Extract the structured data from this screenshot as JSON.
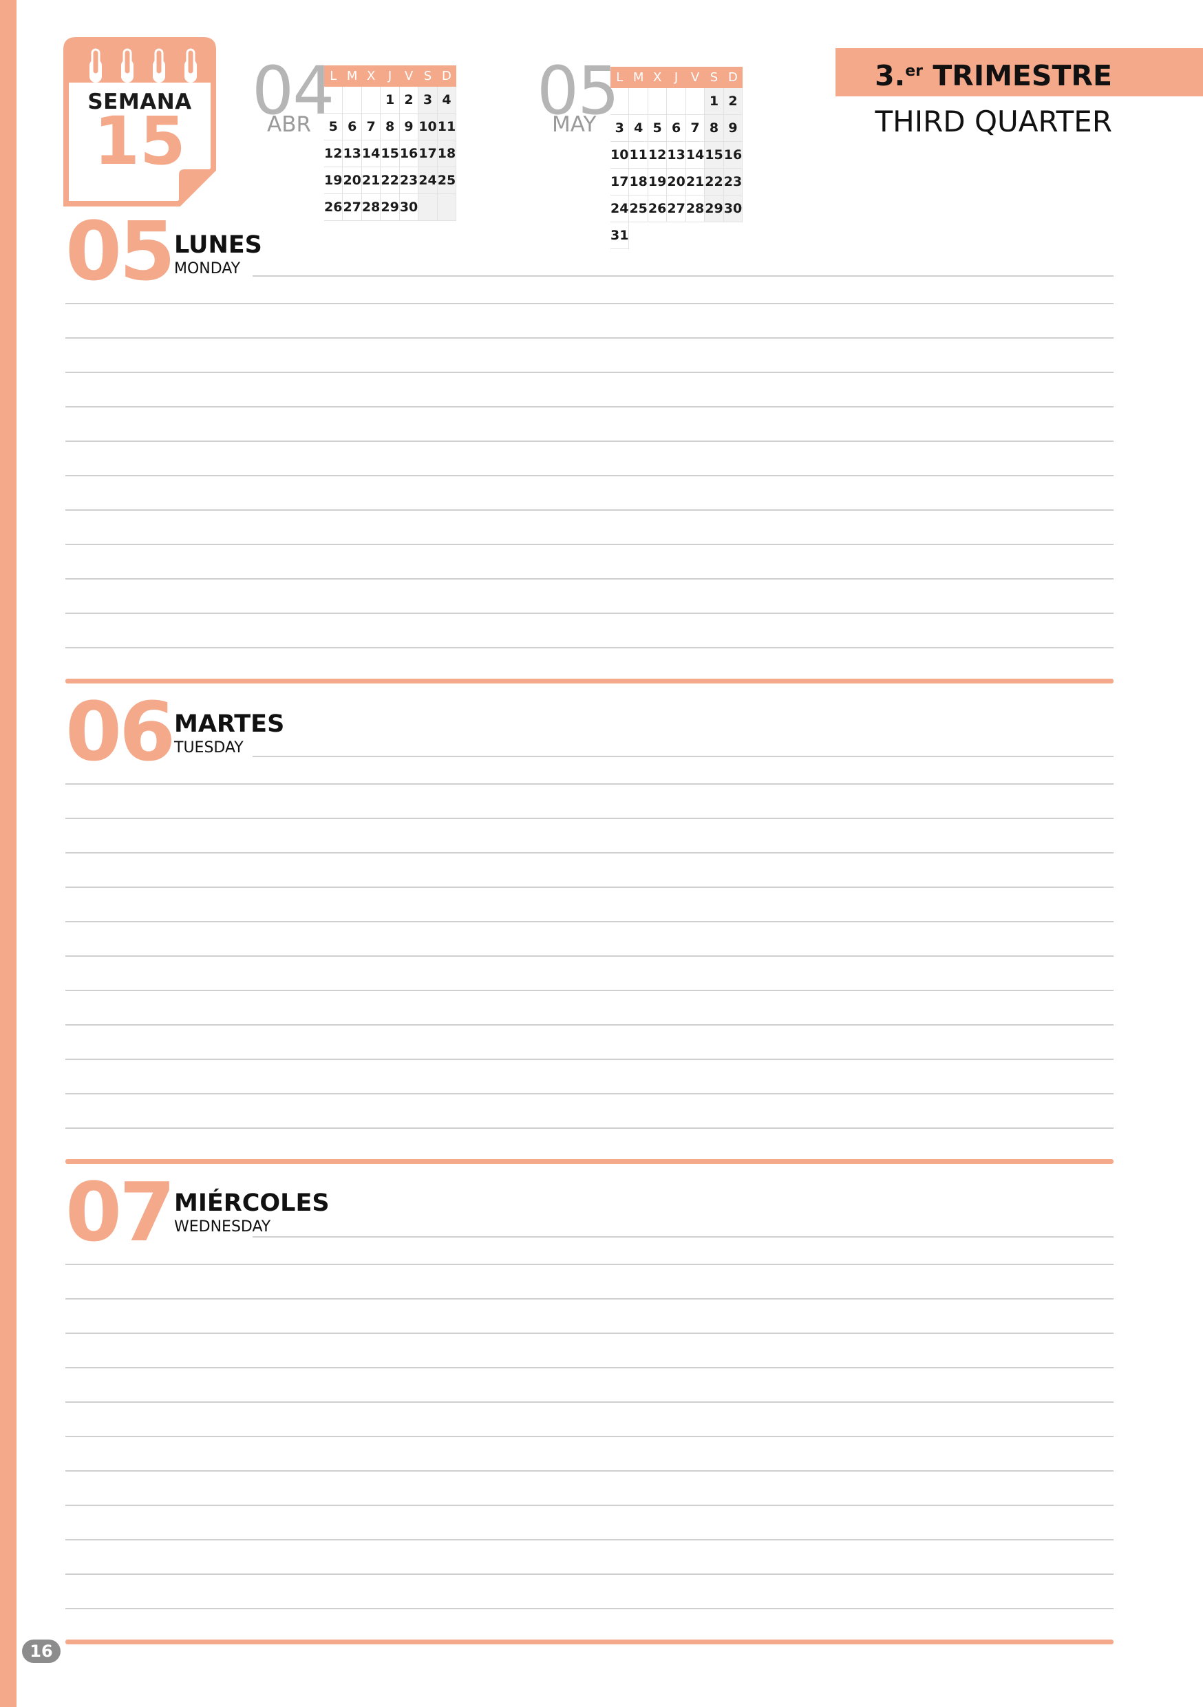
{
  "week": {
    "label": "SEMANA",
    "number": "15"
  },
  "calendars": [
    {
      "month_num": "04",
      "month_name": "ABR",
      "weekday_headers": [
        "L",
        "M",
        "X",
        "J",
        "V",
        "S",
        "D"
      ],
      "weeks": [
        [
          "",
          "",
          "",
          "1",
          "2",
          "3",
          "4"
        ],
        [
          "5",
          "6",
          "7",
          "8",
          "9",
          "10",
          "11"
        ],
        [
          "12",
          "13",
          "14",
          "15",
          "16",
          "17",
          "18"
        ],
        [
          "19",
          "20",
          "21",
          "22",
          "23",
          "24",
          "25"
        ],
        [
          "26",
          "27",
          "28",
          "29",
          "30",
          "",
          ""
        ]
      ]
    },
    {
      "month_num": "05",
      "month_name": "MAY",
      "weekday_headers": [
        "L",
        "M",
        "X",
        "J",
        "V",
        "S",
        "D"
      ],
      "weeks": [
        [
          "",
          "",
          "",
          "",
          "",
          "1",
          "2"
        ],
        [
          "3",
          "4",
          "5",
          "6",
          "7",
          "8",
          "9"
        ],
        [
          "10",
          "11",
          "12",
          "13",
          "14",
          "15",
          "16"
        ],
        [
          "17",
          "18",
          "19",
          "20",
          "21",
          "22",
          "23"
        ],
        [
          "24",
          "25",
          "26",
          "27",
          "28",
          "29",
          "30"
        ],
        [
          "31"
        ]
      ]
    }
  ],
  "quarter": {
    "title": "3.",
    "superscript": "er",
    "title_rest": "TRIMESTRE",
    "subtitle": "THIRD QUARTER"
  },
  "days": [
    {
      "number": "05",
      "name": "LUNES",
      "name_en": "MONDAY"
    },
    {
      "number": "06",
      "name": "MARTES",
      "name_en": "TUESDAY"
    },
    {
      "number": "07",
      "name": "MIÉRCOLES",
      "name_en": "WEDNESDAY"
    }
  ],
  "page_number": "16",
  "colors": {
    "accent": "#f4a98b",
    "month_gray": "#b5b5b5",
    "rule_gray": "#cfcfcf"
  }
}
